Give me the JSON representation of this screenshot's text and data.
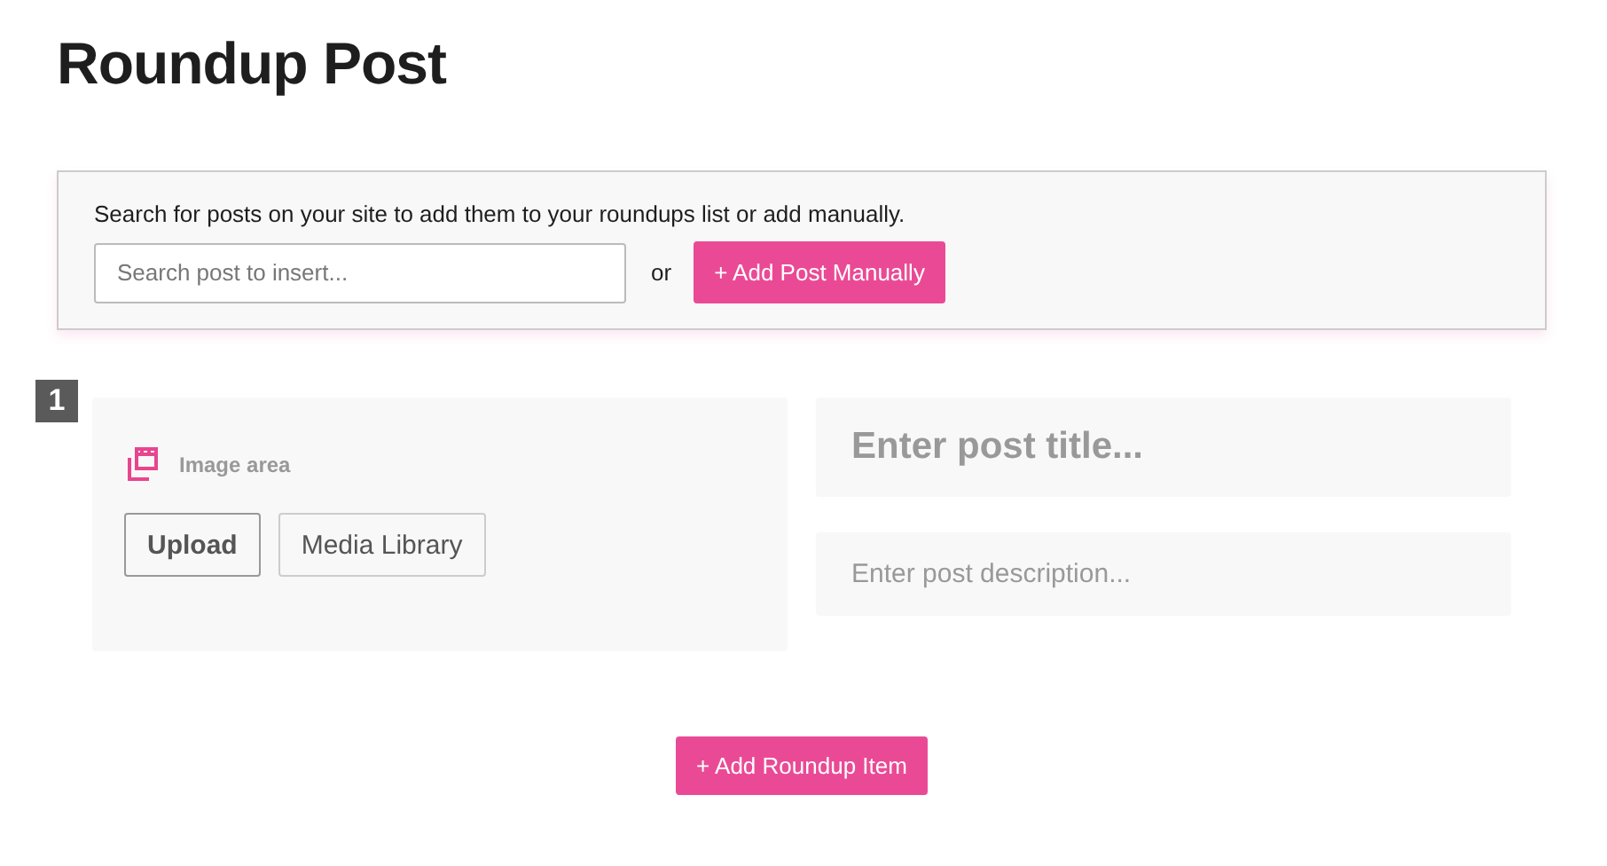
{
  "title": "Roundup Post",
  "search_panel": {
    "intro": "Search for posts on your site to add them to your roundups list or add manually.",
    "search": {
      "placeholder": "Search post to insert..."
    },
    "or": "or",
    "add_manually_button": "+ Add Post Manually"
  },
  "items": [
    {
      "number": "1",
      "image_area": {
        "label": "Image area",
        "buttons": [
          "Upload",
          "Media Library"
        ]
      },
      "title_field": {
        "placeholder": "Enter post title..."
      },
      "description_field": {
        "placeholder": "Enter post description..."
      }
    }
  ],
  "add_item_button": "+ Add Roundup Item"
}
